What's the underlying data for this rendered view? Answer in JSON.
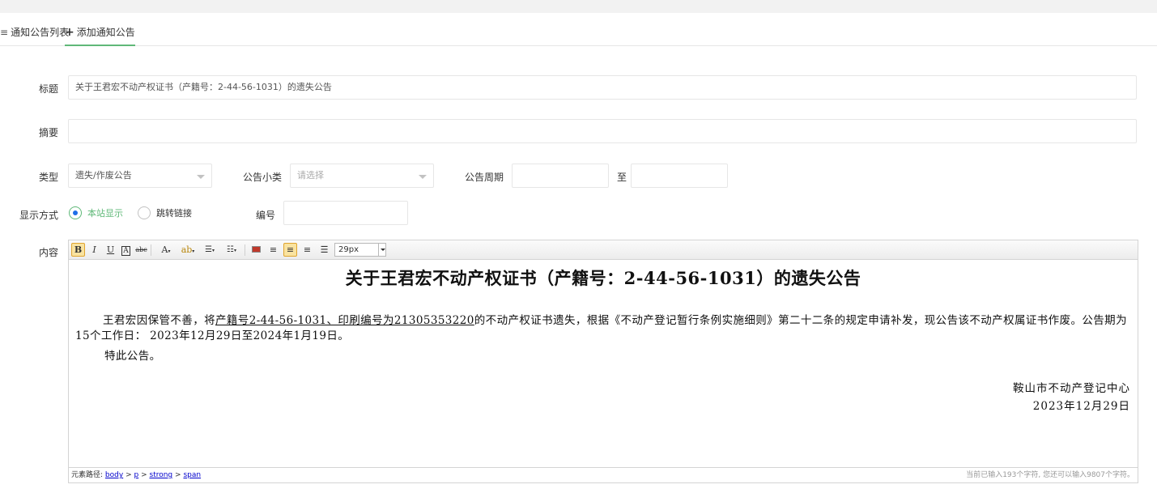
{
  "tabs": {
    "list_label": "通知公告列表",
    "add_label": "添加通知公告"
  },
  "form": {
    "title_label": "标题",
    "title_value": "关于王君宏不动产权证书（产籍号：2-44-56-1031）的遗失公告",
    "summary_label": "摘要",
    "summary_value": "",
    "type_label": "类型",
    "type_value": "遗失/作废公告",
    "subtype_label": "公告小类",
    "subtype_placeholder": "请选择",
    "period_label": "公告周期",
    "period_start": "",
    "period_separator": "至",
    "period_end": "",
    "display_label": "显示方式",
    "display_options": [
      "本站显示",
      "跳转链接"
    ],
    "display_selected": "本站显示",
    "number_label": "编号",
    "number_value": "",
    "content_label": "内容"
  },
  "editor": {
    "font_size": "29px",
    "doc_title": "关于王君宏不动产权证书（产籍号：2-44-56-1031）的遗失公告",
    "para_before": "王君宏因保管不善，将",
    "para_underlined": "产籍号2-44-56-1031、印刷编号为21305353220",
    "para_after": "的不动产权证书遗失，根据《不动产登记暂行条例实施细则》第二十二条的规定申请补发，现公告该不动产权属证书作废。公告期为15个工作日：  2023年12月29日至2024年1月19日。",
    "closing": "特此公告。",
    "signature_org": "鞍山市不动产登记中心",
    "signature_date": "2023年12月29日",
    "path_label": "元素路径:",
    "path_items": [
      "body",
      "p",
      "strong",
      "span"
    ],
    "path_sep": ">",
    "char_count": "当前已输入193个字符, 您还可以输入9807个字符。"
  }
}
